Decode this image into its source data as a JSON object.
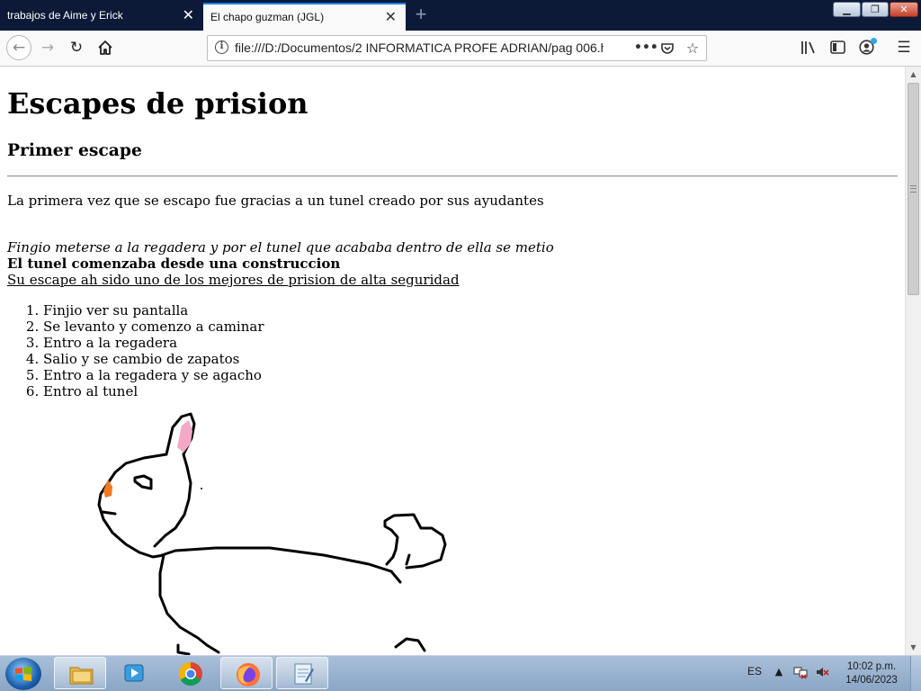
{
  "tabs": [
    {
      "title": "trabajos de Aime y Erick",
      "active": false
    },
    {
      "title": "El chapo guzman (JGL)",
      "active": true
    }
  ],
  "window_controls": {
    "minimize_icon": "minimize-icon",
    "maximize_icon": "restore-icon",
    "close_icon": "close-icon"
  },
  "navbar": {
    "url": "file:///D:/Documentos/2 INFORMATICA PROFE ADRIAN/pag 006.ht",
    "icons": [
      "back-icon",
      "forward-icon",
      "reload-icon",
      "home-icon",
      "info-icon",
      "more-actions-icon",
      "pocket-icon",
      "bookmark-star-icon",
      "library-icon",
      "sidebar-icon",
      "account-icon",
      "menu-icon"
    ]
  },
  "page": {
    "title": "Escapes de prision",
    "subtitle": "Primer escape",
    "paragraph": "La primera vez que se escapo fue gracias a un tunel creado por sus ayudantes",
    "italic_line": "Fingio meterse a la regadera y por el tunel que acababa dentro de ella se metio",
    "bold_line": "El tunel comenzaba desde una construccion",
    "underline_line": "Su escape ah sido uno de los mejores de prision de alta seguridad",
    "steps": [
      "Finjio ver su pantalla",
      "Se levanto y comenzo a caminar",
      "Entro a la regadera",
      "Salio y se cambio de zapatos",
      "Entro a la regadera y se agacho",
      "Entro al tunel"
    ],
    "drawing": {
      "subject": "hand-drawn-rabbit",
      "ear_color": "#f4a8c8",
      "nose_color": "#f07820"
    }
  },
  "taskbar": {
    "apps": [
      "file-explorer-icon",
      "media-player-icon",
      "chrome-icon",
      "firefox-icon",
      "notepad-icon"
    ],
    "active_app": "firefox-icon",
    "language": "ES",
    "time": "10:02 p.m.",
    "date": "14/06/2023"
  },
  "colors": {
    "tabstrip": "#0c1a38",
    "active_tab_accent": "#0a84ff",
    "taskbar": "#a9bfd8"
  }
}
